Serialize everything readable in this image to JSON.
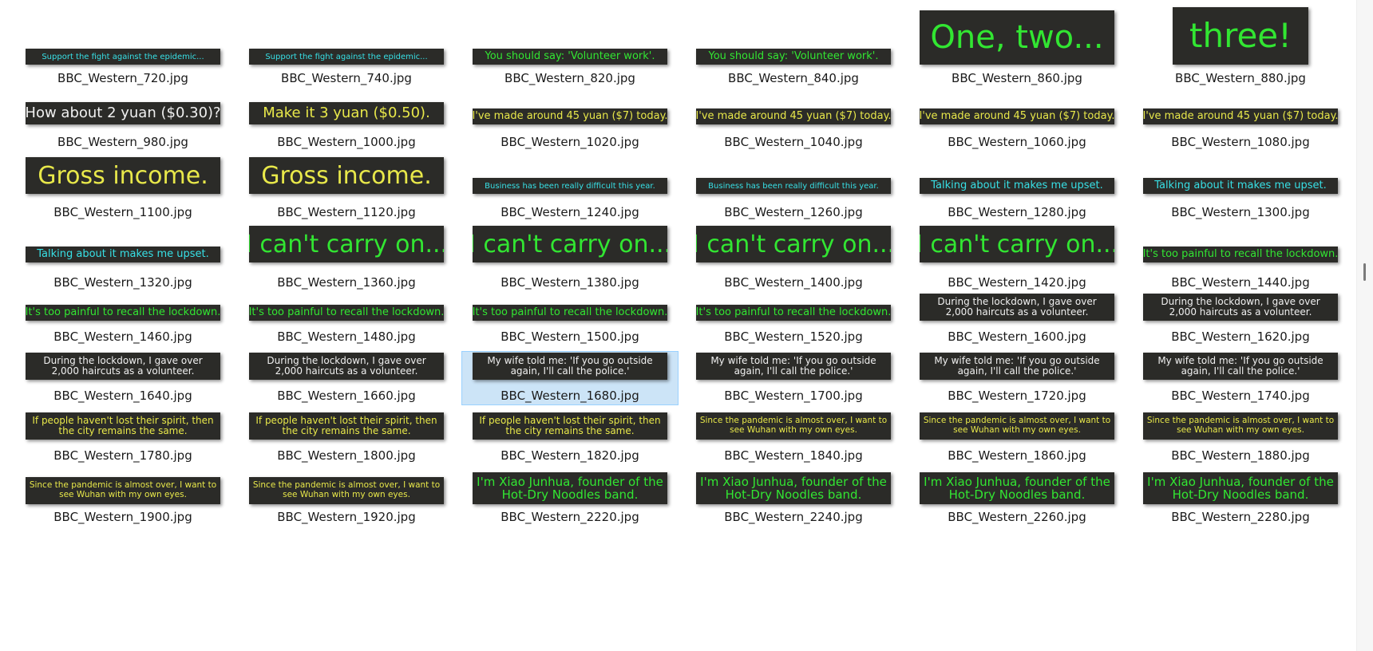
{
  "colors": {
    "caption_bg": "#2b2b28",
    "cyan": "#37e0e6",
    "green": "#32e632",
    "yellow": "#e8e84a",
    "white": "#f0f0f0",
    "selection_bg": "#cce4f7",
    "selection_border": "#99d1ff"
  },
  "files": [
    {
      "name": "BBC_Western_720.jpg",
      "caption": "Support the fight against the epidemic...",
      "color": "cyan"
    },
    {
      "name": "BBC_Western_740.jpg",
      "caption": "Support the fight against the epidemic...",
      "color": "cyan"
    },
    {
      "name": "BBC_Western_820.jpg",
      "caption": "You should say: 'Volunteer work'.",
      "color": "green"
    },
    {
      "name": "BBC_Western_840.jpg",
      "caption": "You should say: 'Volunteer work'.",
      "color": "green"
    },
    {
      "name": "BBC_Western_860.jpg",
      "caption": "One, two...",
      "color": "green"
    },
    {
      "name": "BBC_Western_880.jpg",
      "caption": "three!",
      "color": "green"
    },
    {
      "name": "BBC_Western_980.jpg",
      "caption": "How about 2 yuan ($0.30)?",
      "color": "white"
    },
    {
      "name": "BBC_Western_1000.jpg",
      "caption": "Make it 3 yuan ($0.50).",
      "color": "yellow"
    },
    {
      "name": "BBC_Western_1020.jpg",
      "caption": "I've made around 45 yuan ($7) today.",
      "color": "yellow"
    },
    {
      "name": "BBC_Western_1040.jpg",
      "caption": "I've made around 45 yuan ($7) today.",
      "color": "yellow"
    },
    {
      "name": "BBC_Western_1060.jpg",
      "caption": "I've made around 45 yuan ($7) today.",
      "color": "yellow"
    },
    {
      "name": "BBC_Western_1080.jpg",
      "caption": "I've made around 45 yuan ($7) today.",
      "color": "yellow"
    },
    {
      "name": "BBC_Western_1100.jpg",
      "caption": "Gross income.",
      "color": "yellow"
    },
    {
      "name": "BBC_Western_1120.jpg",
      "caption": "Gross income.",
      "color": "yellow"
    },
    {
      "name": "BBC_Western_1240.jpg",
      "caption": "Business has been really difficult this year.",
      "color": "cyan"
    },
    {
      "name": "BBC_Western_1260.jpg",
      "caption": "Business has been really difficult this year.",
      "color": "cyan"
    },
    {
      "name": "BBC_Western_1280.jpg",
      "caption": "Talking about it makes me upset.",
      "color": "cyan"
    },
    {
      "name": "BBC_Western_1300.jpg",
      "caption": "Talking about it makes me upset.",
      "color": "cyan"
    },
    {
      "name": "BBC_Western_1320.jpg",
      "caption": "Talking about it makes me upset.",
      "color": "cyan"
    },
    {
      "name": "BBC_Western_1360.jpg",
      "caption": "I can't carry on...",
      "color": "green"
    },
    {
      "name": "BBC_Western_1380.jpg",
      "caption": "I can't carry on...",
      "color": "green"
    },
    {
      "name": "BBC_Western_1400.jpg",
      "caption": "I can't carry on...",
      "color": "green"
    },
    {
      "name": "BBC_Western_1420.jpg",
      "caption": "I can't carry on...",
      "color": "green"
    },
    {
      "name": "BBC_Western_1440.jpg",
      "caption": "It's too painful to recall the lockdown.",
      "color": "green"
    },
    {
      "name": "BBC_Western_1460.jpg",
      "caption": "It's too painful to recall the lockdown.",
      "color": "green"
    },
    {
      "name": "BBC_Western_1480.jpg",
      "caption": "It's too painful to recall the lockdown.",
      "color": "green"
    },
    {
      "name": "BBC_Western_1500.jpg",
      "caption": "It's too painful to recall the lockdown.",
      "color": "green"
    },
    {
      "name": "BBC_Western_1520.jpg",
      "caption": "It's too painful to recall the lockdown.",
      "color": "green"
    },
    {
      "name": "BBC_Western_1600.jpg",
      "caption": "During the lockdown, I gave over 2,000 haircuts as a volunteer.",
      "color": "white"
    },
    {
      "name": "BBC_Western_1620.jpg",
      "caption": "During the lockdown, I gave over 2,000 haircuts as a volunteer.",
      "color": "white"
    },
    {
      "name": "BBC_Western_1640.jpg",
      "caption": "During the lockdown, I gave over 2,000 haircuts as a volunteer.",
      "color": "white"
    },
    {
      "name": "BBC_Western_1660.jpg",
      "caption": "During the lockdown, I gave over 2,000 haircuts as a volunteer.",
      "color": "white"
    },
    {
      "name": "BBC_Western_1680.jpg",
      "caption": "My wife told me: 'If you go outside again, I'll call the police.'",
      "color": "white",
      "selected": true
    },
    {
      "name": "BBC_Western_1700.jpg",
      "caption": "My wife told me: 'If you go outside again, I'll call the police.'",
      "color": "white"
    },
    {
      "name": "BBC_Western_1720.jpg",
      "caption": "My wife told me: 'If you go outside again, I'll call the police.'",
      "color": "white"
    },
    {
      "name": "BBC_Western_1740.jpg",
      "caption": "My wife told me: 'If you go outside again, I'll call the police.'",
      "color": "white"
    },
    {
      "name": "BBC_Western_1780.jpg",
      "caption": "If people haven't lost their spirit, then the city remains the same.",
      "color": "yellow"
    },
    {
      "name": "BBC_Western_1800.jpg",
      "caption": "If people haven't lost their spirit, then the city remains the same.",
      "color": "yellow"
    },
    {
      "name": "BBC_Western_1820.jpg",
      "caption": "If people haven't lost their spirit, then the city remains the same.",
      "color": "yellow"
    },
    {
      "name": "BBC_Western_1840.jpg",
      "caption": "Since the pandemic is almost over, I want to see Wuhan with my own eyes.",
      "color": "yellow"
    },
    {
      "name": "BBC_Western_1860.jpg",
      "caption": "Since the pandemic is almost over, I want to see Wuhan with my own eyes.",
      "color": "yellow"
    },
    {
      "name": "BBC_Western_1880.jpg",
      "caption": "Since the pandemic is almost over, I want to see Wuhan with my own eyes.",
      "color": "yellow"
    },
    {
      "name": "BBC_Western_1900.jpg",
      "caption": "Since the pandemic is almost over, I want to see Wuhan with my own eyes.",
      "color": "yellow"
    },
    {
      "name": "BBC_Western_1920.jpg",
      "caption": "Since the pandemic is almost over, I want to see Wuhan with my own eyes.",
      "color": "yellow"
    },
    {
      "name": "BBC_Western_2220.jpg",
      "caption": "I'm Xiao Junhua, founder of the Hot-Dry Noodles band.",
      "color": "green"
    },
    {
      "name": "BBC_Western_2240.jpg",
      "caption": "I'm Xiao Junhua, founder of the Hot-Dry Noodles band.",
      "color": "green"
    },
    {
      "name": "BBC_Western_2260.jpg",
      "caption": "I'm Xiao Junhua, founder of the Hot-Dry Noodles band.",
      "color": "green"
    },
    {
      "name": "BBC_Western_2280.jpg",
      "caption": "I'm Xiao Junhua, founder of the Hot-Dry Noodles band.",
      "color": "green"
    }
  ]
}
